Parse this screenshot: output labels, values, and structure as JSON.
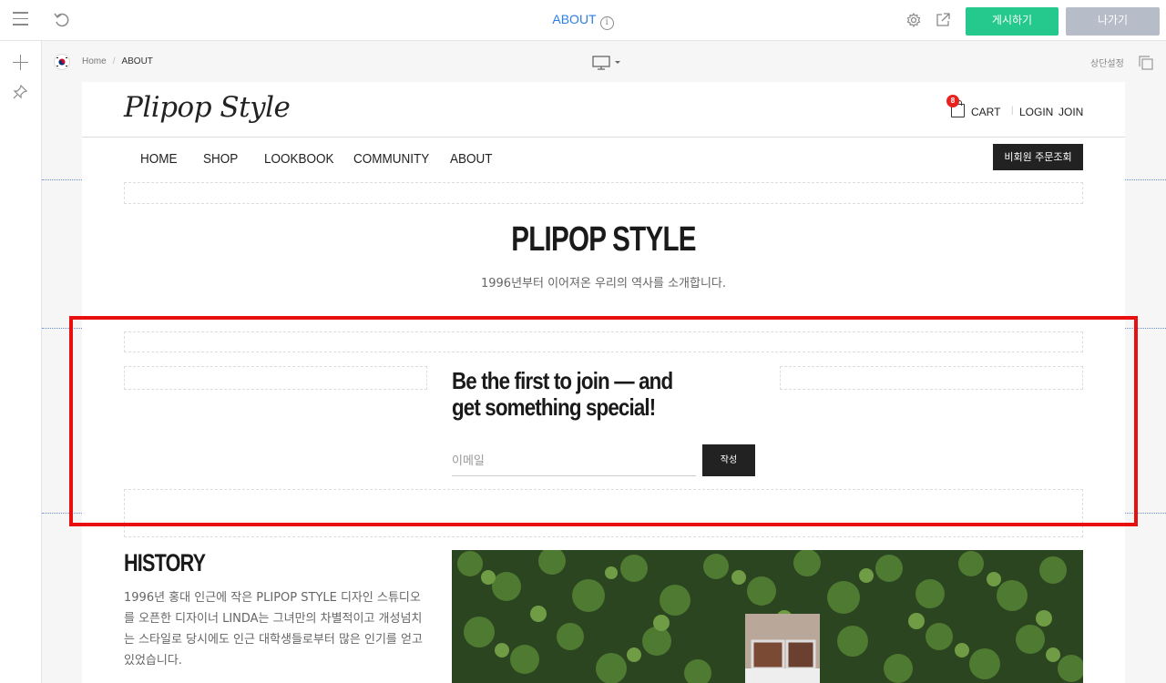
{
  "toolbar": {
    "page_title": "ABOUT",
    "publish_label": "게시하기",
    "exit_label": "나가기"
  },
  "editor_bar": {
    "breadcrumb": [
      "Home",
      "ABOUT"
    ],
    "header_settings_label": "상단설정"
  },
  "site": {
    "logo": "Plipop Style",
    "cart_label": "CART",
    "cart_count": "8",
    "login_label": "LOGIN",
    "join_label": "JOIN",
    "nav": [
      "HOME",
      "SHOP",
      "LOOKBOOK",
      "COMMUNITY",
      "ABOUT"
    ],
    "order_lookup_label": "비회원 주문조회",
    "hero": {
      "title": "PLIPOP STYLE",
      "subtitle": "1996년부터 이어져온 우리의 역사를 소개합니다."
    },
    "subscribe": {
      "heading": "Be the first to join — and get something special!",
      "email_placeholder": "이메일",
      "submit_label": "작성"
    },
    "history": {
      "title": "HISTORY",
      "text": "1996년 홍대 인근에 작은 PLIPOP STYLE 디자인 스튜디오를 오픈한 디자이너 LINDA는 그녀만의 차별적이고 개성넘치는 스타일로 당시에도 인근 대학생들로부터 많은 인기를 얻고 있었습니다."
    }
  },
  "colors": {
    "accent_blue": "#2b7de9",
    "publish_green": "#25c98d",
    "exit_gray": "#b7bdc8",
    "highlight_red": "#e8100f",
    "badge_red": "#e8231f"
  },
  "icons": [
    "menu-icon",
    "undo-icon",
    "info-icon",
    "gear-icon",
    "external-link-icon",
    "plus-icon",
    "pin-icon",
    "korea-flag-icon",
    "desktop-icon",
    "copy-icon",
    "shopping-bag-icon"
  ]
}
